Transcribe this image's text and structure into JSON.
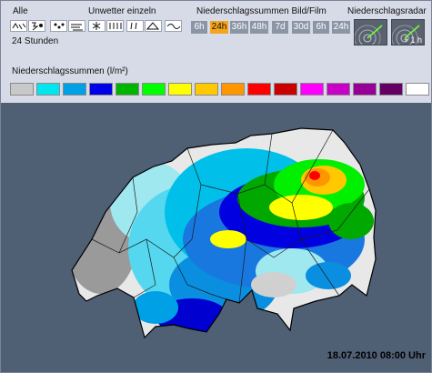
{
  "header": {
    "alle_label": "Alle",
    "unwetter_label": "Unwetter einzeln",
    "summen_label": "Niederschlagssummen Bild/Film",
    "radar_label": "Niederschlagsradar",
    "period_label": "24 Stunden",
    "radar_forecast_label": "+ 1 h"
  },
  "filter_icons": [
    "all-weather-icon",
    "thunderstorm-icon",
    "hail-icon",
    "wind-icon",
    "snow-icon",
    "heavy-rain-icon",
    "rain-icon",
    "frost-icon",
    "storm-icon"
  ],
  "bild_buttons": [
    "6h",
    "24h",
    "36h",
    "48h",
    "7d",
    "30d"
  ],
  "bild_active": "24h",
  "film_buttons": [
    "6h",
    "24h"
  ],
  "legend": {
    "title": "Niederschlagssummen (l/m²)",
    "colors": [
      "#c8c8c8",
      "#00e5ee",
      "#00a0e6",
      "#0000e6",
      "#00b400",
      "#00ff00",
      "#ffff00",
      "#ffc800",
      "#ff9600",
      "#ff0000",
      "#c80000",
      "#ff00ff",
      "#c800c8",
      "#960096",
      "#640064",
      "#ffffff"
    ]
  },
  "map": {
    "background": "#4f5f74",
    "datetime": "18.07.2010 08:00 Uhr"
  }
}
